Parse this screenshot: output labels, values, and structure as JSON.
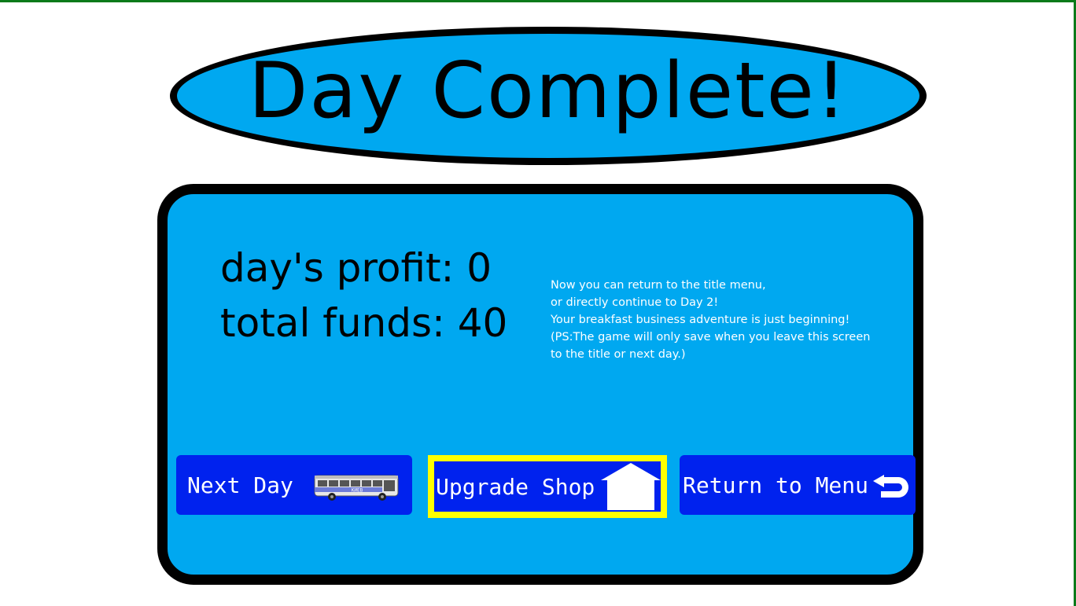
{
  "title": "Day Complete!",
  "stats": {
    "profit_line": "day's profit: 0",
    "funds_line": "total funds: 40"
  },
  "message": {
    "lines": [
      "Now you can return to the title menu,",
      "or directly continue to Day 2!",
      "Your breakfast business adventure is just beginning!",
      "(PS:The game will only save when you leave this screen",
      "to the title or next day.)"
    ]
  },
  "buttons": {
    "next_day": {
      "label": "Next Day",
      "icon": "bus-icon",
      "bus_sign": "КИЕВ"
    },
    "upgrade_shop": {
      "label": "Upgrade Shop",
      "icon": "house-icon",
      "selected": true
    },
    "return_menu": {
      "label": "Return to Menu",
      "icon": "return-arrow-icon"
    }
  },
  "colors": {
    "panel": "#00a8f0",
    "button": "#0022ee",
    "selection": "#ffff00",
    "frame": "#0a7a1a"
  }
}
